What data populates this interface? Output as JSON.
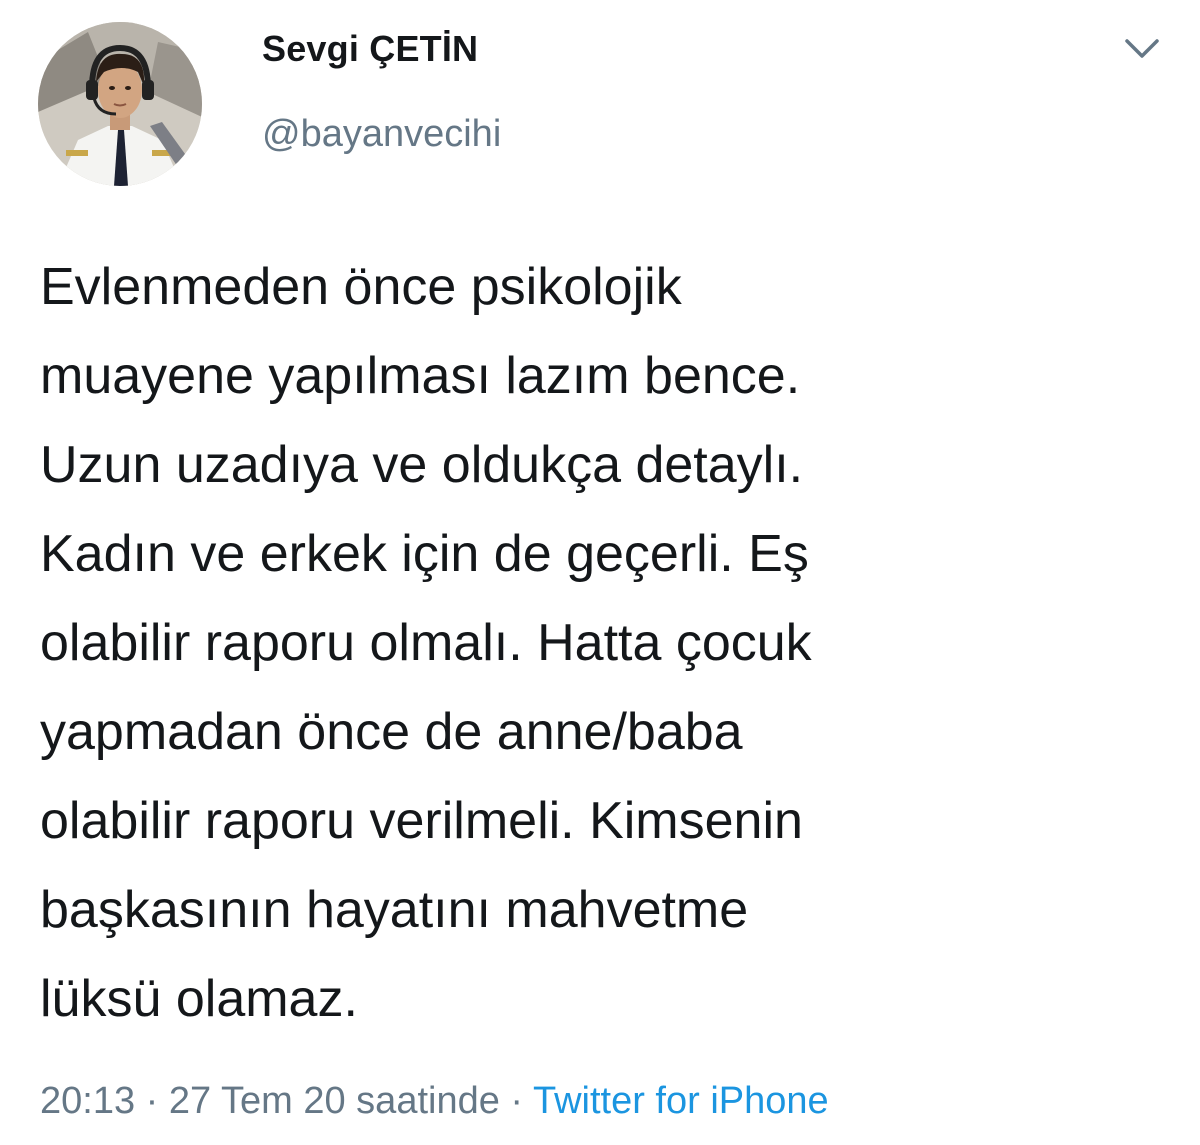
{
  "tweet": {
    "author": {
      "display_name": "Sevgi ÇETİN",
      "handle": "@bayanvecihi"
    },
    "text": "Evlenmeden önce psikolojik\nmuayene yapılması lazım bence.\nUzun uzadıya ve oldukça detaylı.\nKadın ve erkek için de geçerli. Eş\nolabilir raporu olmalı. Hatta çocuk\nyapmadan önce de anne/baba\nolabilir raporu verilmeli. Kimsenin\nbaşkasının hayatını mahvetme\nlüksü olamaz.",
    "time": "20:13",
    "separator": "·",
    "date": "27 Tem 20 saatinde",
    "source": "Twitter for iPhone"
  },
  "icons": {
    "avatar": "profile-photo",
    "menu": "chevron-down-icon"
  },
  "colors": {
    "text": "#14171a",
    "secondary": "#657786",
    "link": "#1b95e0",
    "background": "#ffffff"
  }
}
